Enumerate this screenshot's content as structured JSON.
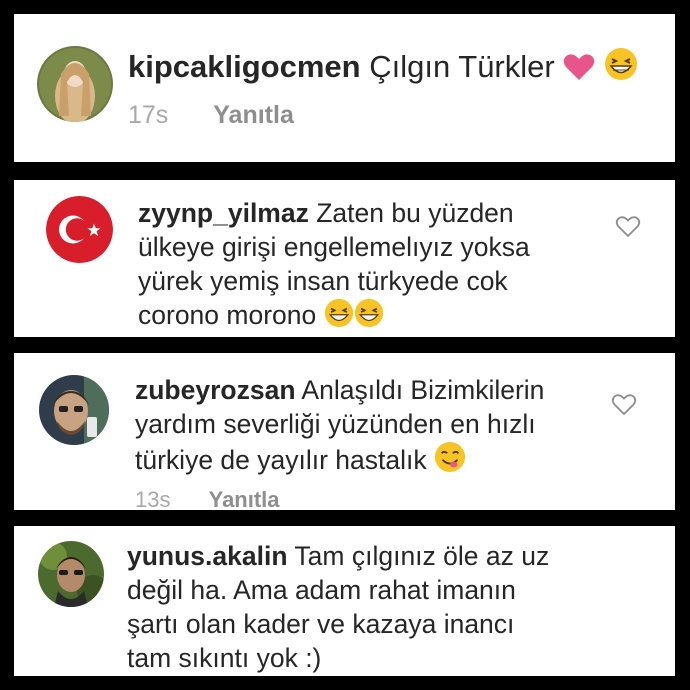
{
  "comments": [
    {
      "username": "kipcakligocmen",
      "text": "Çılgın Türkler",
      "emojis": [
        "heart-icon",
        "grinning-squint-face-icon"
      ],
      "time": "17s",
      "reply_label": "Yanıtla"
    },
    {
      "username": "zyynp_yilmaz",
      "text_lines": [
        "Zaten bu yüzden",
        "ülkeye girişi engellemelıyız yoksa",
        "yürek yemiş insan türkyede cok",
        "corono morono"
      ],
      "emojis": [
        "grinning-squint-face-icon",
        "grinning-squint-face-icon"
      ]
    },
    {
      "username": "zubeyrozsan",
      "text_lines": [
        "Anlaşıldı Bizimkilerin",
        "yardım severliği yüzünden en hızlı",
        "türkiye de yayılır hastalık"
      ],
      "emojis": [
        "face-savoring-food-icon"
      ],
      "time": "13s",
      "reply_label": "Yanıtla"
    },
    {
      "username": "yunus.akalin",
      "text_lines": [
        "Tam çılgınız öle az uz",
        "değil ha. Ama adam rahat imanın",
        "şartı olan kader ve kazaya inancı",
        "tam sıkıntı yok :)"
      ]
    }
  ],
  "colors": {
    "text": "#262626",
    "meta": "#999999",
    "heart": "#e8548c",
    "emoji": "#f7c325"
  }
}
